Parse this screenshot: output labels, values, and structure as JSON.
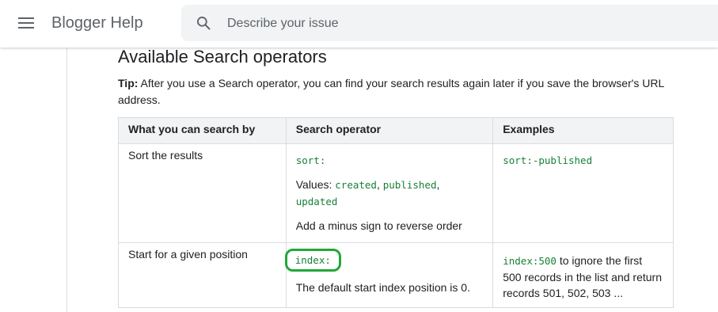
{
  "header": {
    "menu_icon": "hamburger-menu-icon",
    "title": "Blogger Help",
    "search": {
      "icon": "search-icon",
      "placeholder": "Describe your issue",
      "value": ""
    }
  },
  "article": {
    "heading": "Available Search operators",
    "tip_label": "Tip:",
    "tip_text": " After you use a Search operator, you can find your search results again later if you save the browser's URL address.",
    "table": {
      "headers": [
        "What you can search by",
        "Search operator",
        "Examples"
      ],
      "rows": [
        {
          "what": "Sort the results",
          "operator": "sort:",
          "values_label": "Values: ",
          "values": [
            "created",
            "published",
            "updated"
          ],
          "note": "Add a minus sign to reverse order",
          "example_code": "sort:-published"
        },
        {
          "what": "Start for a given position",
          "operator": "index:",
          "note": "The default start index position is 0.",
          "example_code": "index:500",
          "example_text": " to ignore the first 500 records in the list and return records 501, 502, 503 ..."
        }
      ]
    },
    "highlight_color": "#21a838",
    "code_color": "#188038"
  }
}
